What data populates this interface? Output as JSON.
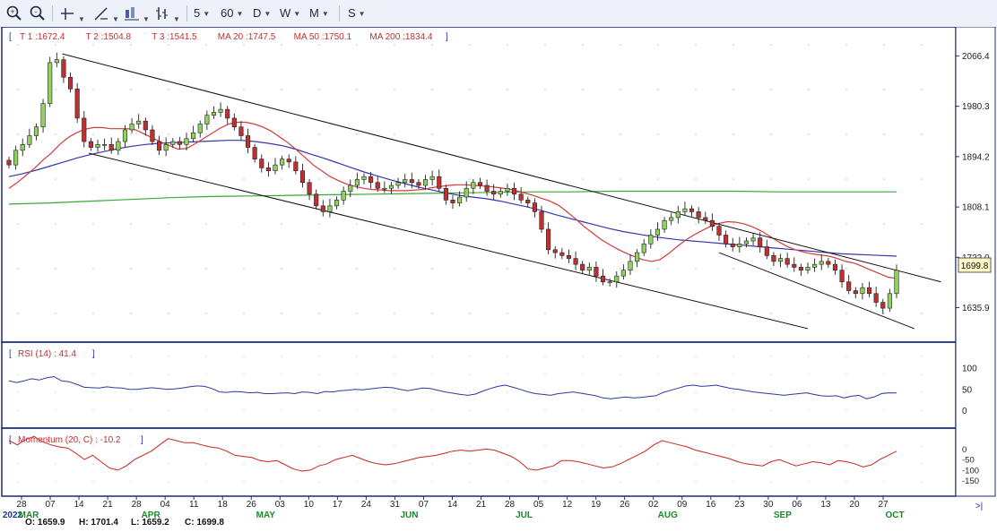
{
  "toolbar": {
    "zoom_in_label": "+",
    "zoom_out_label": "-",
    "period_5": "5",
    "period_60": "60",
    "period_d": "D",
    "period_w": "W",
    "period_m": "M",
    "study_s": "S"
  },
  "colors": {
    "up": "#8fd35f",
    "down": "#c03030",
    "ma20": "#d23a3a",
    "ma50": "#3636a8",
    "ma200": "#38a838",
    "rsi": "#2c3a9a",
    "momentum": "#cc2222",
    "frame": "#1a2a7a",
    "axis_text": "#222222",
    "header_text": "#c03030",
    "bracket": "#2233aa"
  },
  "header": {
    "open_bracket": "[",
    "close_bracket": "]",
    "items": [
      "T 1 :1672.4",
      "T 2 :1504.8",
      "T 3 :1541.5",
      "MA 20 :1747.5",
      "MA 50 :1750.1",
      "MA 200 :1834.4"
    ]
  },
  "rsi_header": "RSI (14) : 41.4",
  "momentum_header": "Momentum (20, C) : -10.2",
  "price_axis": [
    "2066.4",
    "1980.3",
    "1894.2",
    "1808.1",
    "1722.0",
    "1635.9"
  ],
  "price_label": "1699.8",
  "rsi_axis": [
    "100",
    "50",
    "0"
  ],
  "momentum_axis": [
    "0",
    "-50",
    "-100",
    "-150"
  ],
  "date_axis": [
    "28",
    "07",
    "14",
    "21",
    "28",
    "04",
    "11",
    "18",
    "26",
    "03",
    "10",
    "17",
    "24",
    "31",
    "07",
    "14",
    "21",
    "28",
    "05",
    "12",
    "19",
    "26",
    "02",
    "09",
    "16",
    "23",
    "30",
    "06",
    "13",
    "20",
    "27"
  ],
  "month_labels": [
    "2022",
    "MAR",
    "APR",
    "MAY",
    "JUN",
    "JUL",
    "AUG",
    "SEP",
    "OCT"
  ],
  "scroll_marker": ">|",
  "ohlc": {
    "open": "O: 1659.9",
    "high": "H: 1701.4",
    "low": "L: 1659.2",
    "close": "C: 1699.8"
  },
  "chart_data": {
    "type": "candlestick",
    "instrument_interval": "daily",
    "y_range": [
      1580,
      2110
    ],
    "closes": [
      1880,
      1905,
      1915,
      1930,
      1945,
      1985,
      2055,
      2060,
      2030,
      2010,
      1960,
      1920,
      1910,
      1915,
      1915,
      1905,
      1920,
      1940,
      1950,
      1955,
      1940,
      1920,
      1905,
      1915,
      1920,
      1915,
      1925,
      1935,
      1950,
      1965,
      1970,
      1975,
      1960,
      1945,
      1930,
      1910,
      1890,
      1875,
      1870,
      1880,
      1890,
      1885,
      1870,
      1850,
      1830,
      1810,
      1800,
      1810,
      1820,
      1835,
      1845,
      1855,
      1860,
      1850,
      1840,
      1840,
      1845,
      1850,
      1855,
      1850,
      1845,
      1855,
      1860,
      1840,
      1820,
      1815,
      1825,
      1840,
      1850,
      1845,
      1835,
      1830,
      1835,
      1840,
      1830,
      1820,
      1815,
      1800,
      1770,
      1735,
      1730,
      1725,
      1720,
      1710,
      1700,
      1705,
      1690,
      1680,
      1680,
      1690,
      1700,
      1715,
      1730,
      1745,
      1760,
      1770,
      1785,
      1790,
      1800,
      1805,
      1800,
      1790,
      1785,
      1775,
      1760,
      1745,
      1740,
      1745,
      1750,
      1755,
      1740,
      1725,
      1715,
      1720,
      1710,
      1705,
      1700,
      1705,
      1710,
      1715,
      1710,
      1700,
      1680,
      1665,
      1660,
      1670,
      1660,
      1645,
      1635,
      1660,
      1699.8
    ],
    "ma20": [
      1840,
      1850,
      1862,
      1874,
      1888,
      1900,
      1915,
      1927,
      1935,
      1941,
      1944,
      1944,
      1942,
      1942,
      1942,
      1940,
      1933,
      1926,
      1919,
      1913,
      1907,
      1908,
      1916,
      1925,
      1934,
      1943,
      1950,
      1953,
      1953,
      1950,
      1945,
      1938,
      1928,
      1918,
      1906,
      1893,
      1880,
      1870,
      1860,
      1853,
      1847,
      1843,
      1840,
      1838,
      1837,
      1836,
      1836,
      1836,
      1837,
      1838,
      1841,
      1843,
      1845,
      1846,
      1846,
      1845,
      1844,
      1843,
      1841,
      1839,
      1836,
      1832,
      1828,
      1823,
      1818,
      1811,
      1800,
      1788,
      1775,
      1764,
      1753,
      1744,
      1736,
      1729,
      1723,
      1718,
      1715,
      1718,
      1728,
      1740,
      1751,
      1760,
      1768,
      1775,
      1780,
      1783,
      1782,
      1779,
      1774,
      1767,
      1758,
      1749,
      1741,
      1735,
      1731,
      1728,
      1726,
      1724,
      1720,
      1715,
      1712,
      1706,
      1700,
      1694,
      1688,
      1686
    ],
    "ma50": [
      1860,
      1865,
      1871,
      1878,
      1885,
      1892,
      1898,
      1903,
      1908,
      1912,
      1915,
      1917,
      1918,
      1919,
      1920,
      1921,
      1922,
      1922,
      1920,
      1917,
      1913,
      1907,
      1899,
      1892,
      1884,
      1876,
      1868,
      1861,
      1854,
      1848,
      1842,
      1837,
      1832,
      1828,
      1825,
      1822,
      1818,
      1813,
      1808,
      1802,
      1795,
      1789,
      1783,
      1777,
      1771,
      1766,
      1762,
      1758,
      1755,
      1752,
      1750,
      1748,
      1746,
      1744,
      1742,
      1740,
      1738,
      1736,
      1734,
      1732,
      1730,
      1728,
      1727,
      1726,
      1725,
      1724
    ],
    "ma200": [
      1813,
      1815,
      1818,
      1821,
      1824,
      1826,
      1827,
      1828,
      1829,
      1830,
      1831,
      1832,
      1833,
      1834,
      1834,
      1835,
      1835,
      1835,
      1835,
      1834,
      1834,
      1834,
      1834
    ],
    "trendlines": [
      {
        "points": [
          [
            0.06,
            2070
          ],
          [
            1.05,
            1680
          ]
        ]
      },
      {
        "points": [
          [
            0.09,
            1900
          ],
          [
            0.9,
            1600
          ]
        ]
      },
      {
        "points": [
          [
            0.8,
            1730
          ],
          [
            1.02,
            1600
          ]
        ]
      }
    ],
    "rsi": {
      "range": [
        -20,
        140
      ],
      "values": [
        70,
        66,
        70,
        75,
        72,
        77,
        80,
        70,
        68,
        62,
        55,
        54,
        53,
        56,
        54,
        53,
        50,
        50,
        52,
        54,
        52,
        50,
        51,
        53,
        56,
        58,
        57,
        52,
        44,
        43,
        45,
        44,
        42,
        43,
        40,
        40,
        41,
        42,
        40,
        44,
        43,
        40,
        45,
        44,
        47,
        48,
        50,
        49,
        51,
        53,
        55,
        54,
        50,
        47,
        50,
        53,
        52,
        48,
        44,
        41,
        38,
        36,
        39,
        46,
        52,
        57,
        60,
        55,
        50,
        44,
        40,
        38,
        36,
        40,
        42,
        44,
        41,
        38,
        35,
        30,
        28,
        30,
        32,
        30,
        31,
        33,
        35,
        43,
        48,
        53,
        58,
        60,
        57,
        58,
        60,
        56,
        52,
        50,
        47,
        44,
        42,
        40,
        38,
        36,
        38,
        40,
        42,
        38,
        35,
        34,
        35,
        30,
        34,
        36,
        28,
        32,
        40,
        42,
        41.4
      ]
    },
    "momentum": {
      "range": [
        -190,
        40
      ],
      "values": [
        40,
        20,
        45,
        60,
        35,
        20,
        10,
        5,
        -20,
        -50,
        -30,
        -60,
        -90,
        -100,
        -80,
        -50,
        -30,
        -10,
        20,
        50,
        40,
        30,
        30,
        20,
        10,
        5,
        -10,
        -30,
        -35,
        -40,
        -55,
        -60,
        -55,
        -75,
        -95,
        -105,
        -100,
        -80,
        -70,
        -50,
        -40,
        -30,
        -45,
        -60,
        -70,
        -75,
        -70,
        -60,
        -50,
        -40,
        -35,
        -30,
        -20,
        -10,
        -5,
        -10,
        -5,
        0,
        -5,
        -20,
        -35,
        -60,
        -95,
        -100,
        -90,
        -80,
        -55,
        -55,
        -60,
        -70,
        -80,
        -90,
        -85,
        -70,
        -50,
        -30,
        -10,
        20,
        40,
        30,
        20,
        10,
        -5,
        -15,
        -25,
        -35,
        -45,
        -60,
        -70,
        -75,
        -80,
        -60,
        -50,
        -65,
        -80,
        -70,
        -60,
        -65,
        -75,
        -55,
        -60,
        -70,
        -85,
        -75,
        -50,
        -30,
        -10.2
      ]
    }
  }
}
